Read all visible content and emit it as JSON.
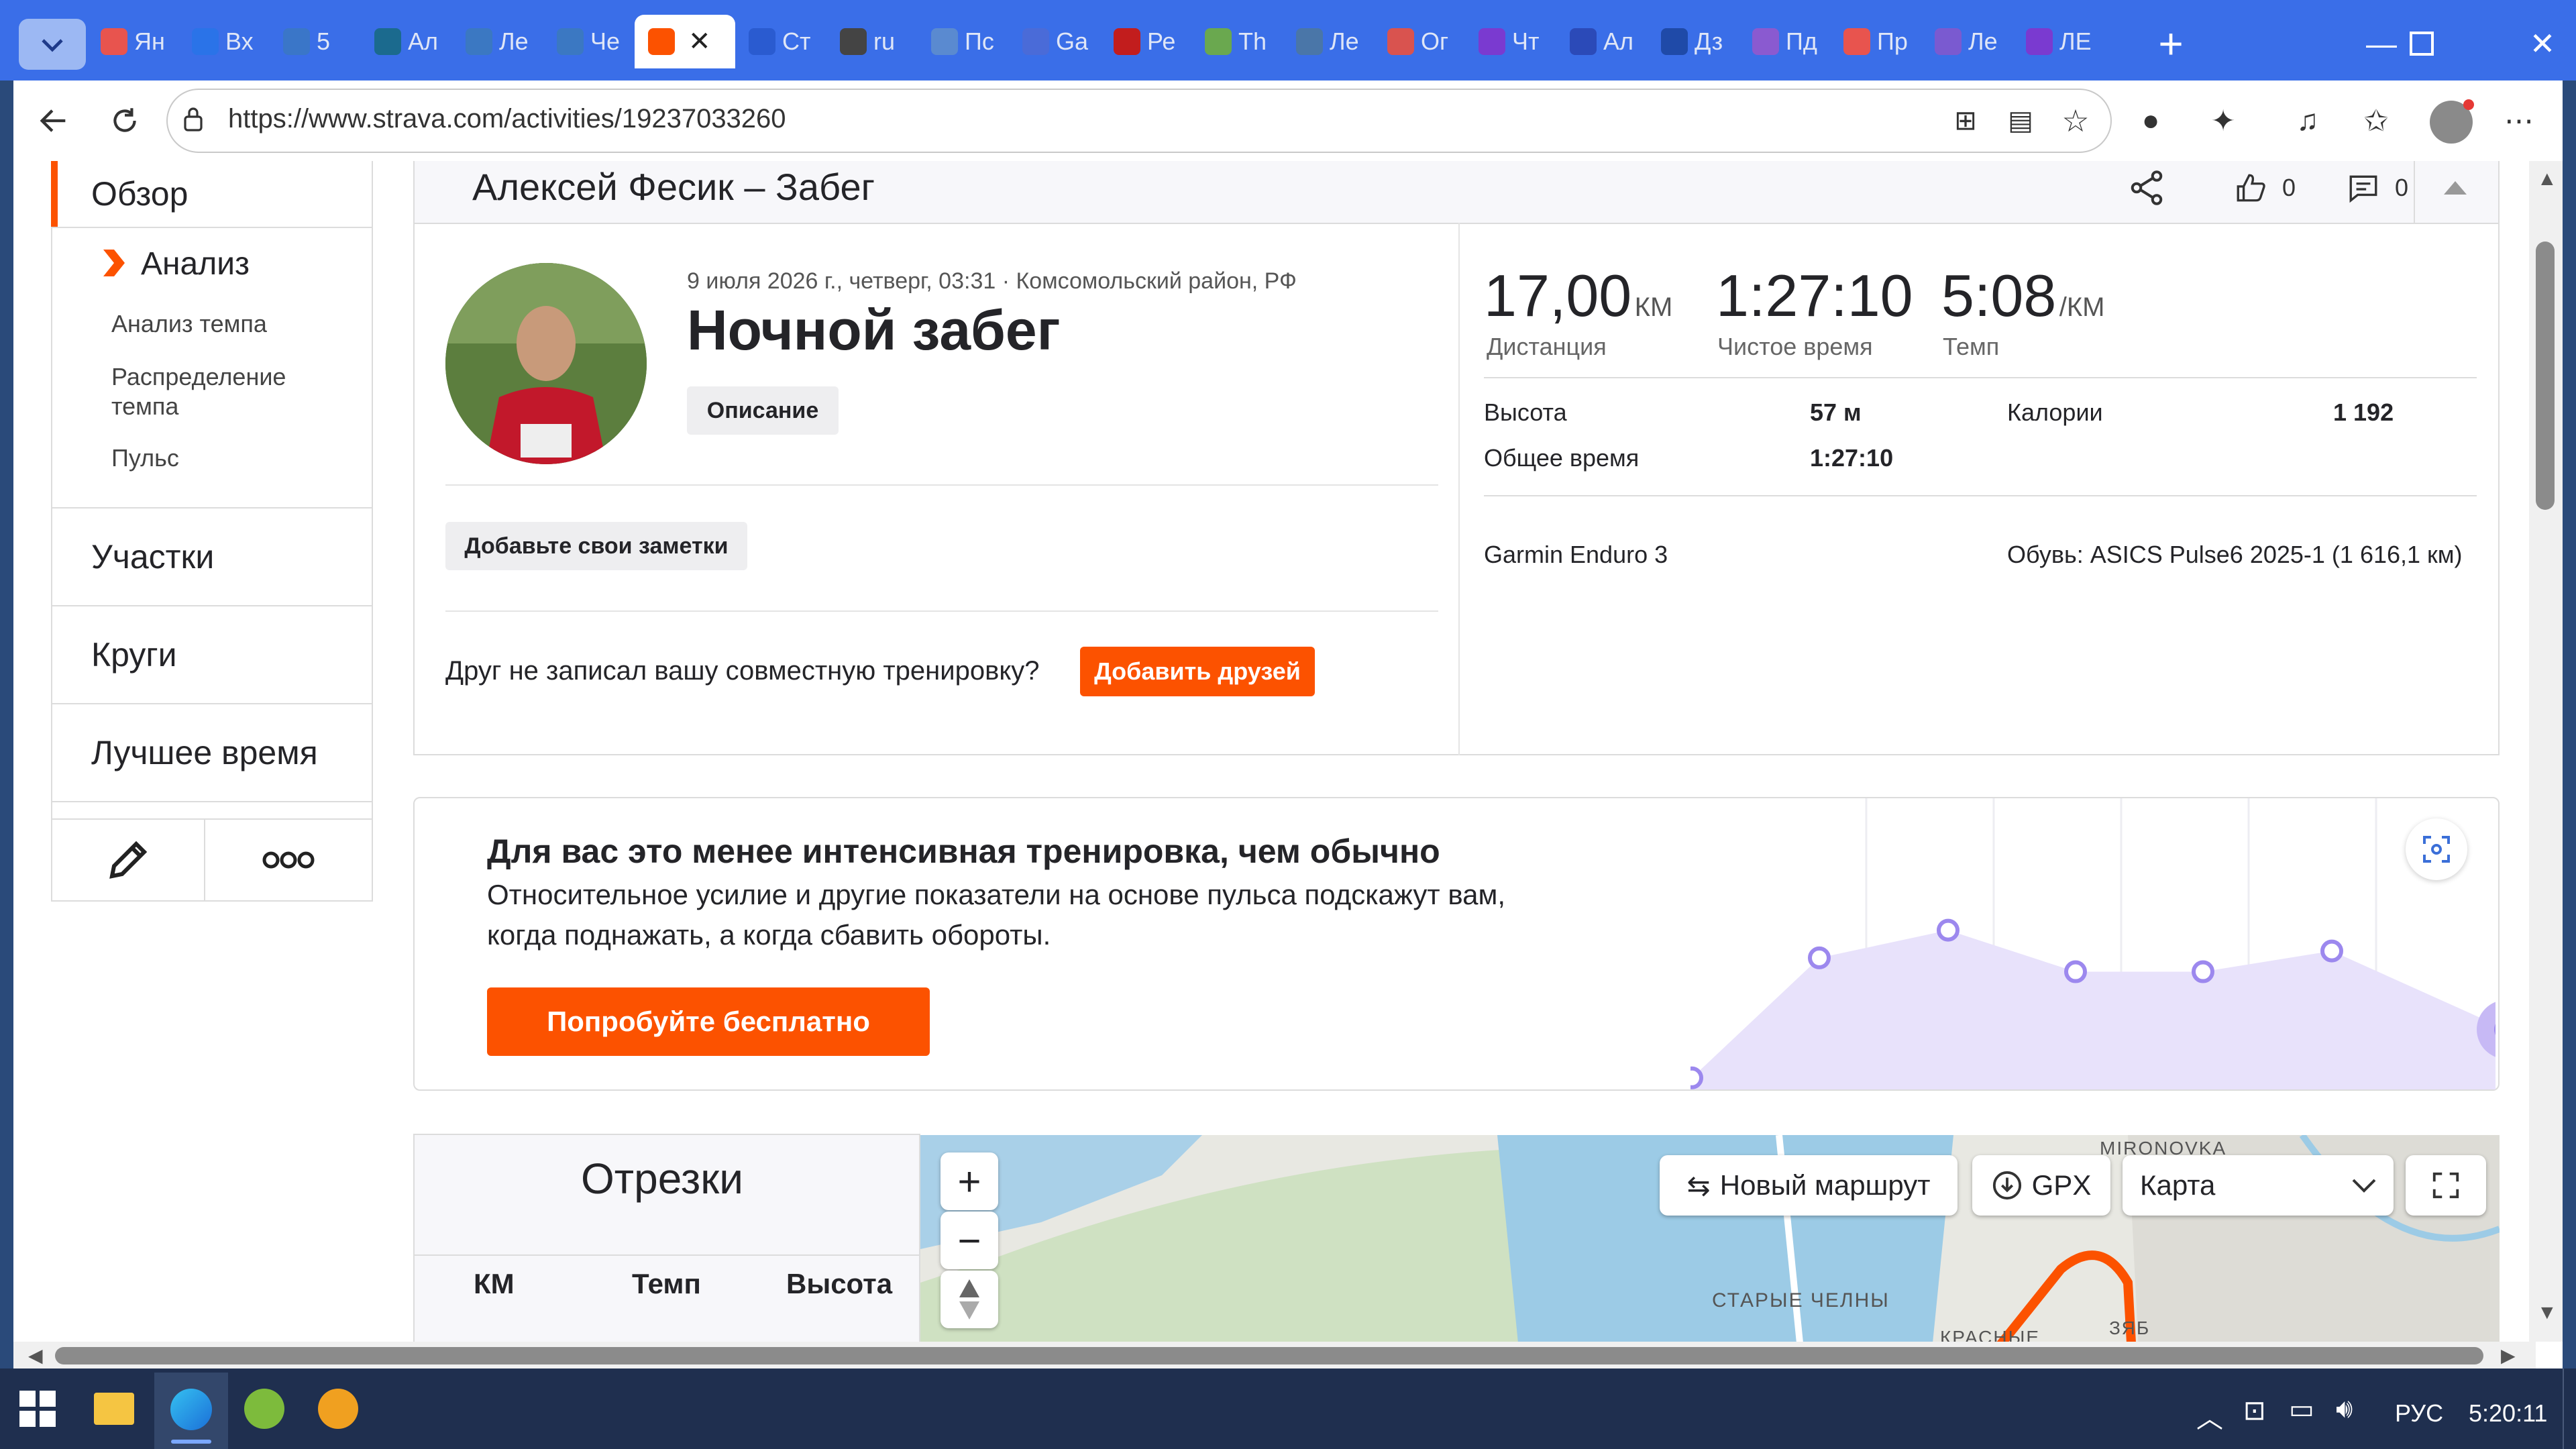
{
  "browser": {
    "tabs": [
      {
        "label": "Ян",
        "color": "#e8544e"
      },
      {
        "label": "Вх",
        "color": "#2a73e8"
      },
      {
        "label": "5 ",
        "color": "#3a76c8"
      },
      {
        "label": "Ал",
        "color": "#1b6a8e"
      },
      {
        "label": "Ле",
        "color": "#3b78c2"
      },
      {
        "label": "Че",
        "color": "#3b78c2"
      },
      {
        "label": "",
        "color": "#fc5200",
        "active": true
      },
      {
        "label": "Ст",
        "color": "#2a5bd0"
      },
      {
        "label": "ru",
        "color": "#444"
      },
      {
        "label": "Пс",
        "color": "#5a8ad0"
      },
      {
        "label": "Ga",
        "color": "#4a6bd8"
      },
      {
        "label": "Ре",
        "color": "#c21d1d"
      },
      {
        "label": "Th",
        "color": "#6aa84f"
      },
      {
        "label": "Ле",
        "color": "#4a76a8"
      },
      {
        "label": "Ог",
        "color": "#d9534f"
      },
      {
        "label": "Чт",
        "color": "#7a3ad0"
      },
      {
        "label": "Ал",
        "color": "#2b4ab8"
      },
      {
        "label": "Дз",
        "color": "#1f4aa8"
      },
      {
        "label": "Пд",
        "color": "#8a5ad0"
      },
      {
        "label": "Пр",
        "color": "#e8544e"
      },
      {
        "label": "Ле",
        "color": "#7a5ad0"
      },
      {
        "label": "ЛЕ",
        "color": "#7a3ad0"
      }
    ],
    "url": "https://www.strava.com/activities/19237033260"
  },
  "sidebar": {
    "overview": "Обзор",
    "analysis": "Анализ",
    "sub": [
      "Анализ темпа",
      "Распределение темпа",
      "Пульс"
    ],
    "segments": "Участки",
    "laps": "Круги",
    "best": "Лучшее время"
  },
  "header": {
    "title": "Алексей Фесик – Забег",
    "likes": "0",
    "comments": "0"
  },
  "activity": {
    "meta": "9 июля 2026 г., четверг, 03:31 · Комсомольский район, РФ",
    "name": "Ночной забег",
    "description_btn": "Описание",
    "notes_btn": "Добавьте свои заметки",
    "friend_q": "Друг не записал вашу совместную тренировку?",
    "add_friends": "Добавить друзей"
  },
  "stats": {
    "distance": "17,00",
    "distance_unit": "КМ",
    "distance_lbl": "Дистанция",
    "moving": "1:27:10",
    "moving_lbl": "Чистое время",
    "pace": "5:08",
    "pace_unit": "/КМ",
    "pace_lbl": "Темп",
    "elev_lbl": "Высота",
    "elev": "57 м",
    "cal_lbl": "Калории",
    "cal": "1 192",
    "elapsed_lbl": "Общее время",
    "elapsed": "1:27:10",
    "device": "Garmin Enduro 3",
    "shoes": "Обувь: ASICS Pulse6 2025-1 (1 616,1 км)"
  },
  "promo": {
    "title": "Для вас это менее интенсивная тренировка, чем обычно",
    "text1": "Относительное усилие и другие показатели на основе пульса подскажут вам,",
    "text2": "когда поднажать, а когда сбавить обороты.",
    "cta": "Попробуйте бесплатно",
    "chart_points": [
      0.05,
      0.57,
      0.69,
      0.51,
      0.51,
      0.6,
      0.26
    ]
  },
  "splits": {
    "title": "Отрезки",
    "cols": [
      "КМ",
      "Темп",
      "Высота"
    ]
  },
  "map": {
    "new_route": "Новый маршрут",
    "gpx": "GPX",
    "layer": "Карта",
    "labels": [
      "MIRONOVKA",
      "СТАРЫЕ ЧЕЛНЫ",
      "КРАСНЫЕ",
      "ЗЯБ"
    ]
  },
  "taskbar": {
    "lang": "РУС",
    "time": "5:20:11"
  }
}
